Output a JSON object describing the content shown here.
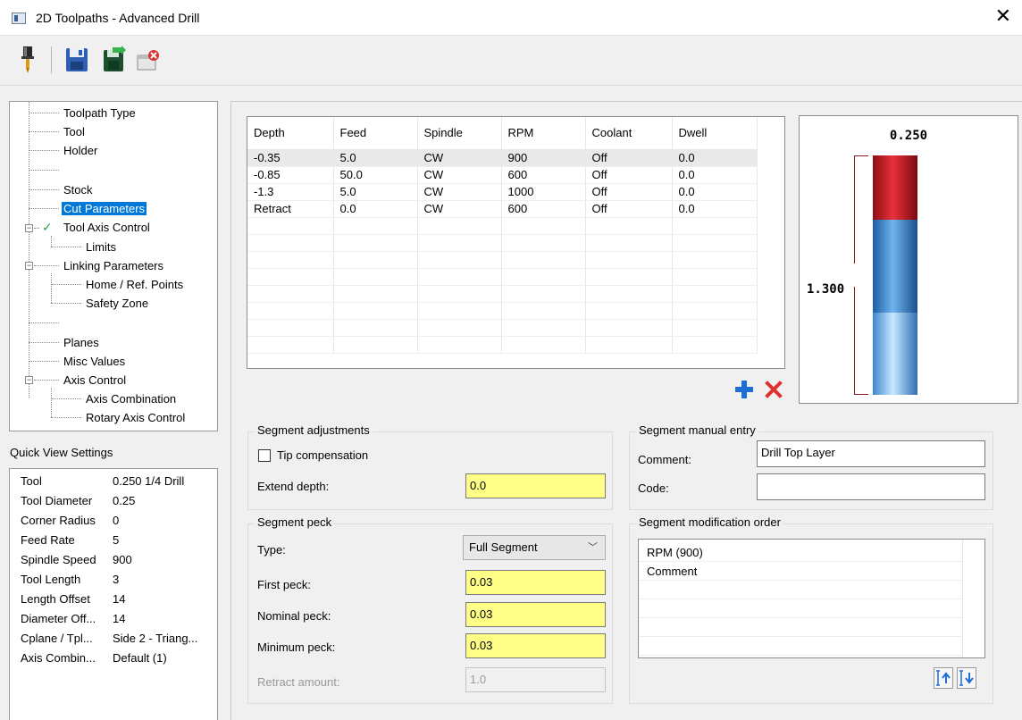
{
  "window": {
    "title": "2D Toolpaths - Advanced Drill",
    "close_glyph": "✕"
  },
  "toolbar": {
    "buttons": [
      {
        "name": "tool-icon"
      },
      {
        "name": "save-icon"
      },
      {
        "name": "save-as-icon"
      },
      {
        "name": "delete-icon"
      }
    ]
  },
  "tree": {
    "items": [
      {
        "label": "Toolpath Type"
      },
      {
        "label": "Tool"
      },
      {
        "label": "Holder"
      },
      {
        "label": ""
      },
      {
        "label": "Stock"
      },
      {
        "label": "Cut Parameters",
        "selected": true
      },
      {
        "label": "Tool Axis Control",
        "checked": true
      },
      {
        "label": "Limits"
      },
      {
        "label": "Linking Parameters"
      },
      {
        "label": "Home / Ref. Points"
      },
      {
        "label": "Safety Zone"
      },
      {
        "label": ""
      },
      {
        "label": "Planes"
      },
      {
        "label": "Misc Values"
      },
      {
        "label": "Axis Control"
      },
      {
        "label": "Axis Combination"
      },
      {
        "label": "Rotary Axis Control"
      }
    ]
  },
  "quick_view": {
    "title": "Quick View Settings",
    "rows": [
      {
        "key": "Tool",
        "value": "0.250 1/4 Drill"
      },
      {
        "key": "Tool Diameter",
        "value": "0.25"
      },
      {
        "key": "Corner Radius",
        "value": "0"
      },
      {
        "key": "Feed Rate",
        "value": "5"
      },
      {
        "key": "Spindle Speed",
        "value": "900"
      },
      {
        "key": "Tool Length",
        "value": "3"
      },
      {
        "key": "Length Offset",
        "value": "14"
      },
      {
        "key": "Diameter Off...",
        "value": "14"
      },
      {
        "key": "Cplane / Tpl...",
        "value": "Side 2 - Triang..."
      },
      {
        "key": "Axis Combin...",
        "value": "Default (1)"
      }
    ]
  },
  "segments_table": {
    "columns": [
      "Depth",
      "Feed",
      "Spindle",
      "RPM",
      "Coolant",
      "Dwell"
    ],
    "rows": [
      [
        "-0.35",
        "5.0",
        "CW",
        "900",
        "Off",
        "0.0"
      ],
      [
        "-0.85",
        "50.0",
        "CW",
        "600",
        "Off",
        "0.0"
      ],
      [
        "-1.3",
        "5.0",
        "CW",
        "1000",
        "Off",
        "0.0"
      ],
      [
        "Retract",
        "0.0",
        "CW",
        "600",
        "Off",
        "0.0"
      ]
    ],
    "selected_row": 0,
    "empty_rows": 8
  },
  "preview": {
    "diameter_label": "0.250",
    "length_label": "1.300",
    "colors": {
      "red": "#d4202a",
      "blue_mid": "#3f8fdf",
      "blue_light": "#9dcff5"
    }
  },
  "segment_adjustments": {
    "title": "Segment adjustments",
    "tip_compensation_label": "Tip compensation",
    "tip_compensation_checked": false,
    "extend_depth_label": "Extend depth:",
    "extend_depth_value": "0.0"
  },
  "segment_peck": {
    "title": "Segment peck",
    "type_label": "Type:",
    "type_value": "Full Segment",
    "first_peck_label": "First peck:",
    "first_peck_value": "0.03",
    "nominal_peck_label": "Nominal peck:",
    "nominal_peck_value": "0.03",
    "minimum_peck_label": "Minimum peck:",
    "minimum_peck_value": "0.03",
    "retract_amount_label": "Retract amount:",
    "retract_amount_value": "1.0"
  },
  "segment_manual_entry": {
    "title": "Segment manual entry",
    "comment_label": "Comment:",
    "comment_value": "Drill Top Layer",
    "code_label": "Code:",
    "code_value": ""
  },
  "segment_modification_order": {
    "title": "Segment modification order",
    "items": [
      "RPM (900)",
      "Comment"
    ],
    "empty_rows": 4
  },
  "accent": {
    "selection": "#0078d7",
    "input_highlight": "#ffff88"
  }
}
